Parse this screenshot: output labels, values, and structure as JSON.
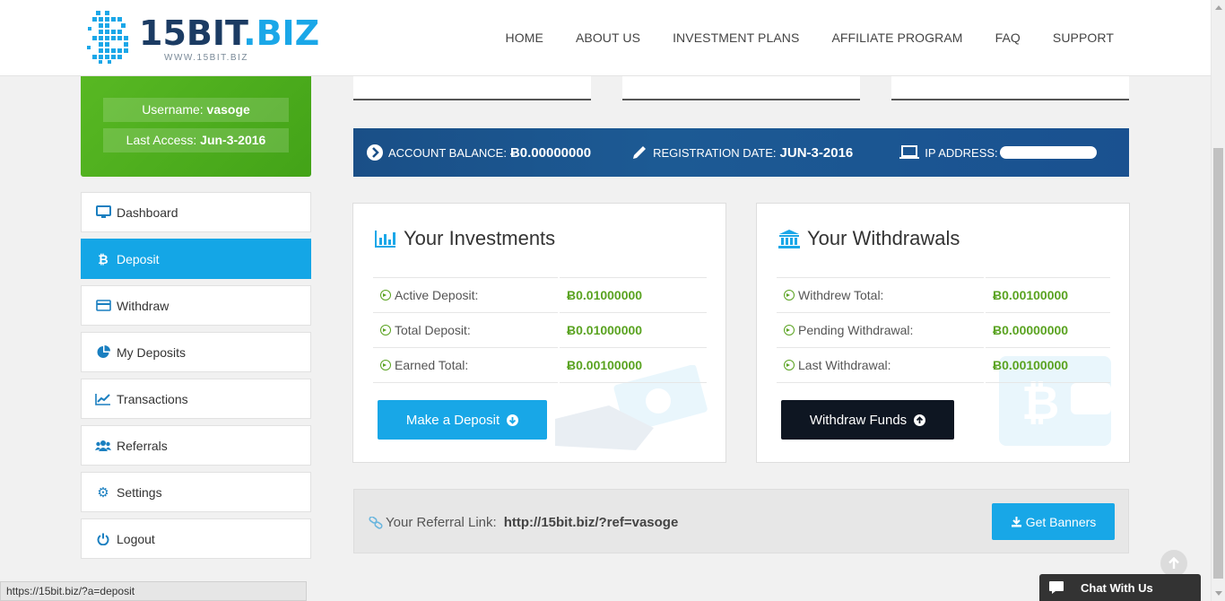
{
  "header": {
    "logo_main": "15BIT",
    "logo_dot": ".BIZ",
    "logo_sub": "WWW.15BIT.BIZ",
    "nav": [
      "HOME",
      "ABOUT US",
      "INVESTMENT PLANS",
      "AFFILIATE PROGRAM",
      "FAQ",
      "SUPPORT"
    ]
  },
  "user": {
    "username_label": "Username:",
    "username": "vasoge",
    "last_access_label": "Last Access:",
    "last_access": "Jun-3-2016"
  },
  "sidebar": {
    "items": [
      {
        "label": "Dashboard",
        "icon": "monitor-icon"
      },
      {
        "label": "Deposit",
        "icon": "bitcoin-icon",
        "active": true
      },
      {
        "label": "Withdraw",
        "icon": "credit-card-icon"
      },
      {
        "label": "My Deposits",
        "icon": "pie-chart-icon"
      },
      {
        "label": "Transactions",
        "icon": "line-chart-icon"
      },
      {
        "label": "Referrals",
        "icon": "users-icon"
      },
      {
        "label": "Settings",
        "icon": "gear-icon"
      },
      {
        "label": "Logout",
        "icon": "power-icon"
      }
    ]
  },
  "account_bar": {
    "balance_label": "ACCOUNT BALANCE:",
    "balance": "Ƀ0.00000000",
    "reg_label": "REGISTRATION DATE:",
    "reg_date": "JUN-3-2016",
    "ip_label": "IP ADDRESS:"
  },
  "investments": {
    "title": "Your Investments",
    "rows": [
      {
        "label": "Active Deposit:",
        "value": "Ƀ0.01000000"
      },
      {
        "label": "Total Deposit:",
        "value": "Ƀ0.01000000"
      },
      {
        "label": "Earned Total:",
        "value": "Ƀ0.00100000"
      }
    ],
    "button": "Make a Deposit"
  },
  "withdrawals": {
    "title": "Your Withdrawals",
    "rows": [
      {
        "label": "Withdrew Total:",
        "value": "Ƀ0.00100000"
      },
      {
        "label": "Pending Withdrawal:",
        "value": "Ƀ0.00000000"
      },
      {
        "label": "Last Withdrawal:",
        "value": "Ƀ0.00100000"
      }
    ],
    "button": "Withdraw Funds"
  },
  "referral": {
    "label": "Your Referral Link:",
    "link": "http://15bit.biz/?ref=vasoge",
    "button": "Get Banners"
  },
  "status_bar": "https://15bit.biz/?a=deposit",
  "chat": "Chat With Us",
  "colors": {
    "accent": "#14a6e6",
    "green": "#5aa321",
    "dark_blue": "#1a4f87",
    "dark_button": "#0e1622"
  }
}
